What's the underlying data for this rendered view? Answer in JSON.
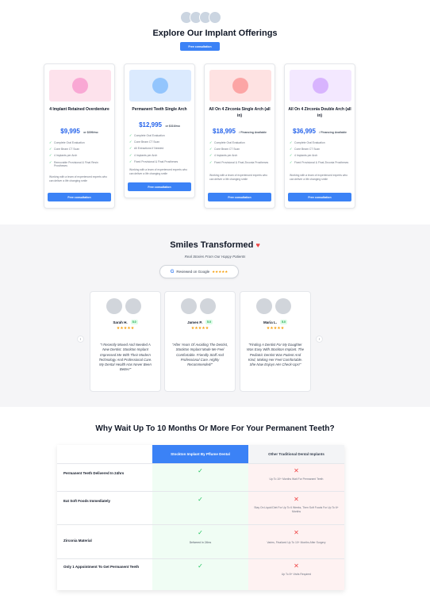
{
  "offerings": {
    "title": "Explore Our Implant Offerings",
    "cta": "Free consultation",
    "cards": [
      {
        "title": "4 Implant Retained Overdenture",
        "price": "$9,995",
        "price_note": "or $399/mo",
        "features": [
          "Complete Oral Evaluation",
          "Cone Beam CT Scan",
          "4 Implants per Arch",
          "Removable Provisional & Final Resin Prostheses"
        ],
        "note": "Working with a team of experienced experts who can deliver a life changing smile",
        "button": "Free consultation",
        "thumb_color": "#fde2ec",
        "dot_color": "#f9a8d4"
      },
      {
        "title": "Permanent Teeth Single Arch",
        "price": "$12,995",
        "price_note": "or $316/mo",
        "features": [
          "Complete Oral Evaluation",
          "Cone Beam CT Scan",
          "All Extractions If Needed",
          "4 Implants per Arch",
          "Fixed Provisional & Final Prostheses"
        ],
        "note": "Working with a team of experienced experts who can deliver a life changing smile",
        "button": "Free consultation",
        "thumb_color": "#dbeafe",
        "dot_color": "#93c5fd"
      },
      {
        "title": "All On 4 Zirconia Single Arch (all in)",
        "price": "$18,995",
        "price_note": "/ Financing Available",
        "features": [
          "Complete Oral Evaluation",
          "Cone Beam CT Scan",
          "4 Implants per Arch",
          "Fixed Provisional & Final Zirconia Prostheses"
        ],
        "note": "Working with a team of experienced experts who can deliver a life changing smile",
        "button": "Free consultation",
        "thumb_color": "#fee2e2",
        "dot_color": "#fca5a5"
      },
      {
        "title": "All On 4 Zirconia Double Arch (all in)",
        "price": "$36,995",
        "price_note": "/ Financing Available",
        "features": [
          "Complete Oral Evaluation",
          "Cone Beam CT Scan",
          "4 Implants per Arch",
          "Fixed Provisional & Final Zirconia Prostheses"
        ],
        "note": "Working with a team of experienced experts who can deliver a life changing smile",
        "button": "Free consultation",
        "thumb_color": "#f3e8ff",
        "dot_color": "#d8b4fe"
      }
    ]
  },
  "testimonials": {
    "title": "Smiles Transformed",
    "heart": "♥",
    "subtitle": "Real Stories From Our Happy Patients",
    "google_label": "Reviewed on Google",
    "google_g": "G",
    "stars": "★★★★★",
    "prev": "‹",
    "next": "›",
    "reviews": [
      {
        "name": "Sarah H.",
        "rating": "5.0",
        "quote": "\"I Recently Moved And Needed A New Dentist. Stockton Implant Impressed Me With Their Modern Technology And Professional Care. My Dental Health Has Never Been Better!\""
      },
      {
        "name": "James P.",
        "rating": "5.0",
        "quote": "\"After Years Of Avoiding The Dentist, Stockton Implant Made Me Feel Comfortable. Friendly Staff And Professional Care. Highly Recommended!\""
      },
      {
        "name": "Maria L.",
        "rating": "5.0",
        "quote": "\"Finding A Dentist For My Daughter Was Easy With Stockton Implant. The Pediatric Dentist Was Patient And Kind, Making Her Feel Comfortable. She Now Enjoys Her Check-Ups!\""
      }
    ]
  },
  "comparison": {
    "title": "Why Wait Up To 10 Months Or More For Your Permanent Teeth?",
    "col_ours": "Stockton Implant By Pflume Dental",
    "col_other": "Other Traditional Dental Implants",
    "check": "✓",
    "cross": "✕",
    "rows": [
      {
        "label": "Permanent Teeth Delivered In 24hrs",
        "ours": "",
        "other": "Up To 10+ Months Wait For Permanent Teeth"
      },
      {
        "label": "Eat Soft Foods Immediately",
        "ours": "",
        "other": "Stay On Liquid Diet For Up To 6 Weeks, Then Soft Foods For Up To 6+ Months"
      },
      {
        "label": "Zirconia Material",
        "ours": "Delivered In 24hrs",
        "other": "Varies, Finalized Up To 10+ Months After Surgery"
      },
      {
        "label": "Only 1 Appointment To Get Permanent Teeth",
        "ours": "",
        "other": "Up To 8+ Visits Required"
      }
    ]
  }
}
